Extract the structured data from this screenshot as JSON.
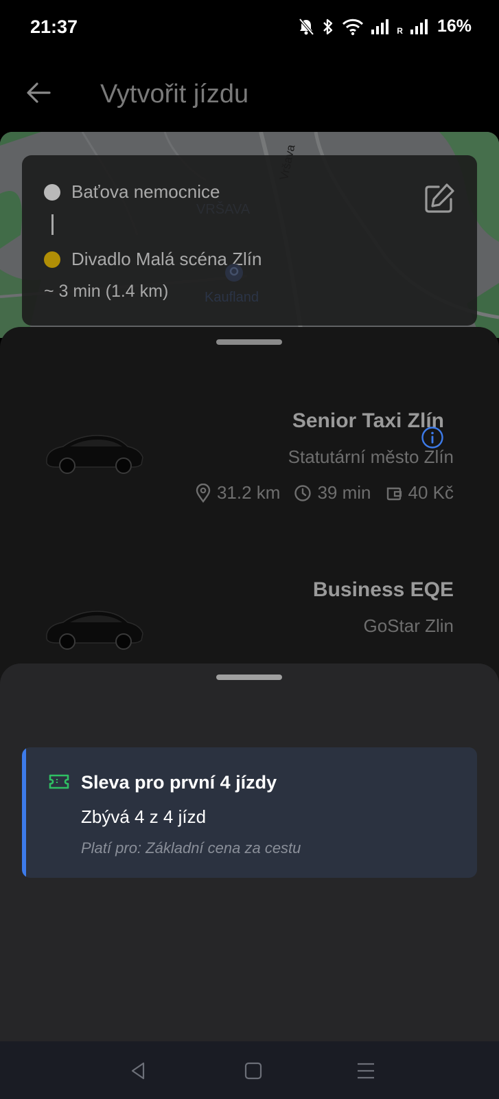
{
  "status_bar": {
    "time": "21:37",
    "network_r": "R",
    "battery": "16%",
    "icons": [
      "mute-bell-icon",
      "bluetooth-icon",
      "wifi-icon",
      "signal-icon",
      "signal-icon",
      "battery-text"
    ]
  },
  "app_bar": {
    "title": "Vytvořit jízdu",
    "back_icon": "arrow-left-icon"
  },
  "map": {
    "labels": [
      "VRŠAVA",
      "Kaufland"
    ],
    "street": "Vršava"
  },
  "route": {
    "origin": "Baťova nemocnice",
    "destination": "Divadlo Malá scéna Zlín",
    "eta": "~ 3 min (1.4 km)",
    "edit_icon": "edit-icon"
  },
  "rides": [
    {
      "name": "Senior Taxi Zlín",
      "provider": "Statutární město Zlín",
      "distance": "31.2 km",
      "duration": "39 min",
      "price": "40 Kč",
      "info_icon": "info-icon"
    },
    {
      "name": "Business EQE",
      "provider": "GoStar Zlin"
    }
  ],
  "discount": {
    "title": "Sleva pro první 4 jízdy",
    "remaining": "Zbývá 4 z 4 jízd",
    "validity": "Platí pro: Základní cena za cestu",
    "accent_color": "#3d7bea",
    "icon_color": "#2fbf63"
  },
  "colors": {
    "destination_dot": "#b08e06",
    "info_icon": "#3d7bea"
  }
}
